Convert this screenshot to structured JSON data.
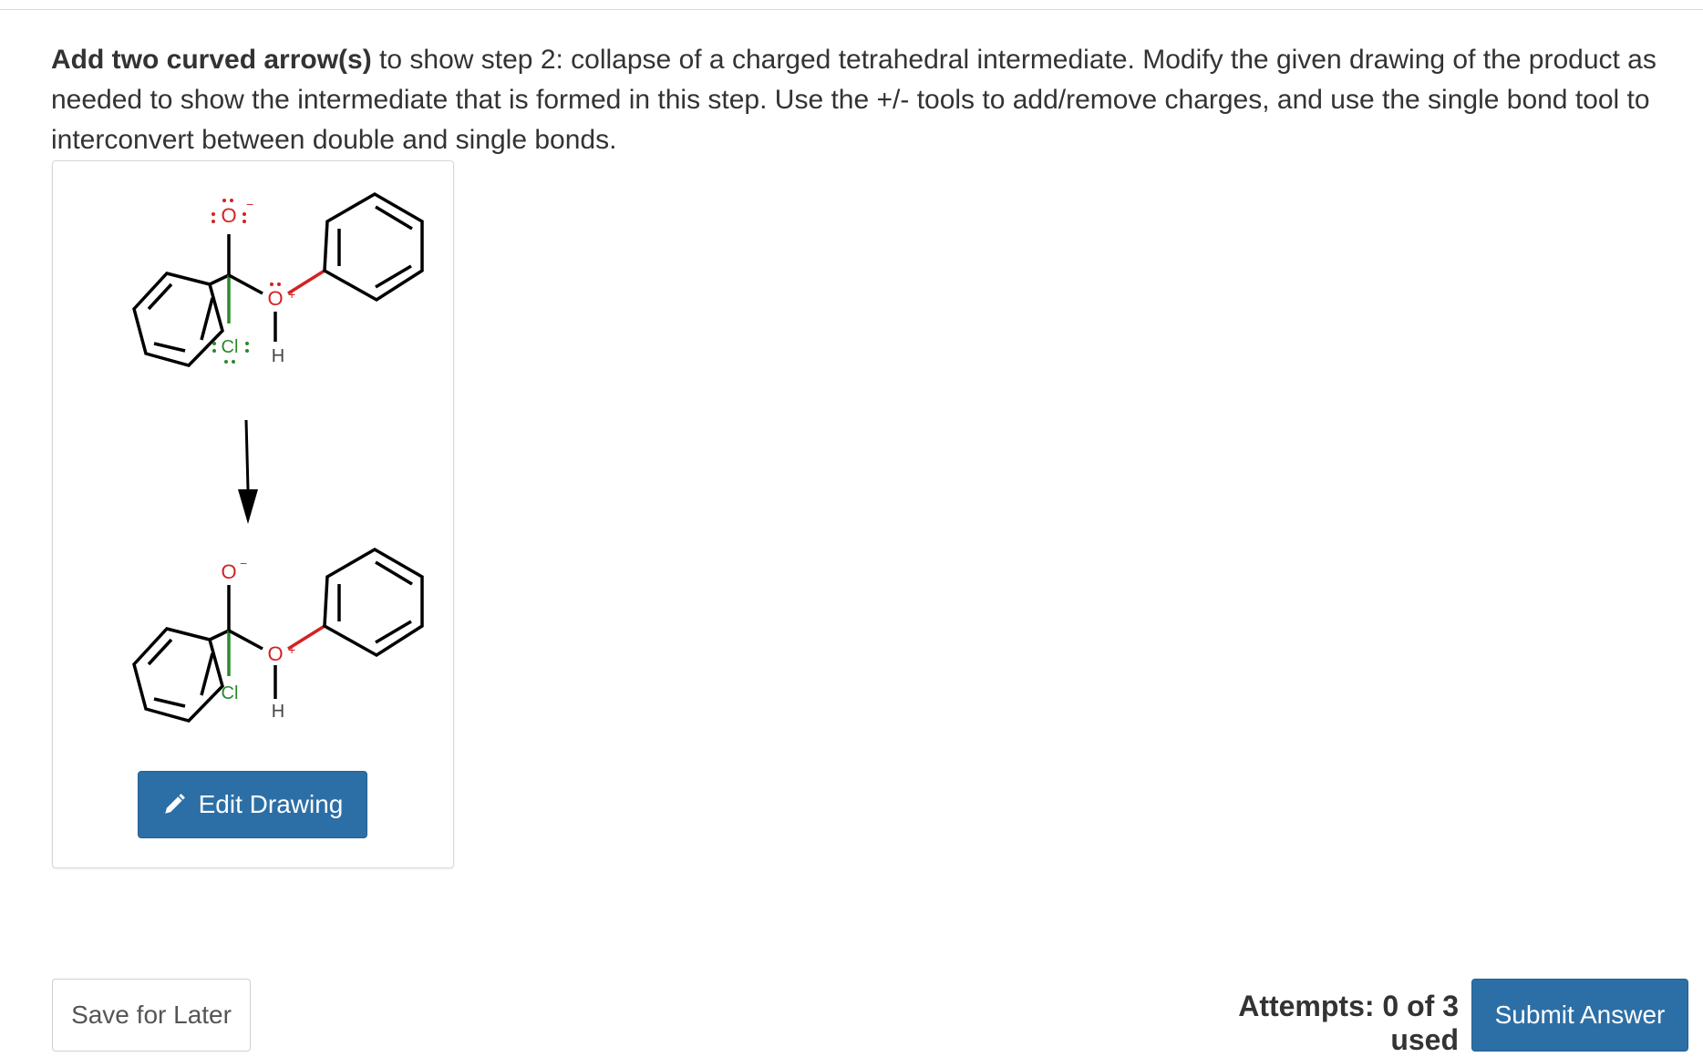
{
  "question": {
    "bold_lead": "Add two curved arrow(s)",
    "text": " to show step 2: collapse of a charged tetrahedral intermediate.  Modify the given drawing of the product as needed to show the intermediate that is formed in this step. Use the +/- tools to add/remove charges, and use the single bond tool to interconvert between double and single bonds."
  },
  "drawing": {
    "top_structure": {
      "oxygen_label": "O",
      "oxygen_charge": "−",
      "bridge_oxygen_label": "O",
      "bridge_oxygen_charge": "+",
      "hydrogen_label": "H",
      "chlorine_label": "Cl"
    },
    "bottom_structure": {
      "oxygen_label": "O",
      "oxygen_charge": "−",
      "bridge_oxygen_label": "O",
      "bridge_oxygen_charge": "+",
      "hydrogen_label": "H",
      "chlorine_label": "Cl"
    },
    "colors": {
      "oxygen": "#d32222",
      "chlorine": "#2a8a2a",
      "bond": "#000000"
    },
    "edit_button_label": "Edit Drawing",
    "edit_button_icon": "pencil-icon"
  },
  "footer": {
    "save_label": "Save for Later",
    "attempts_text": "Attempts: 0 of 3 used",
    "submit_label": "Submit Answer"
  }
}
